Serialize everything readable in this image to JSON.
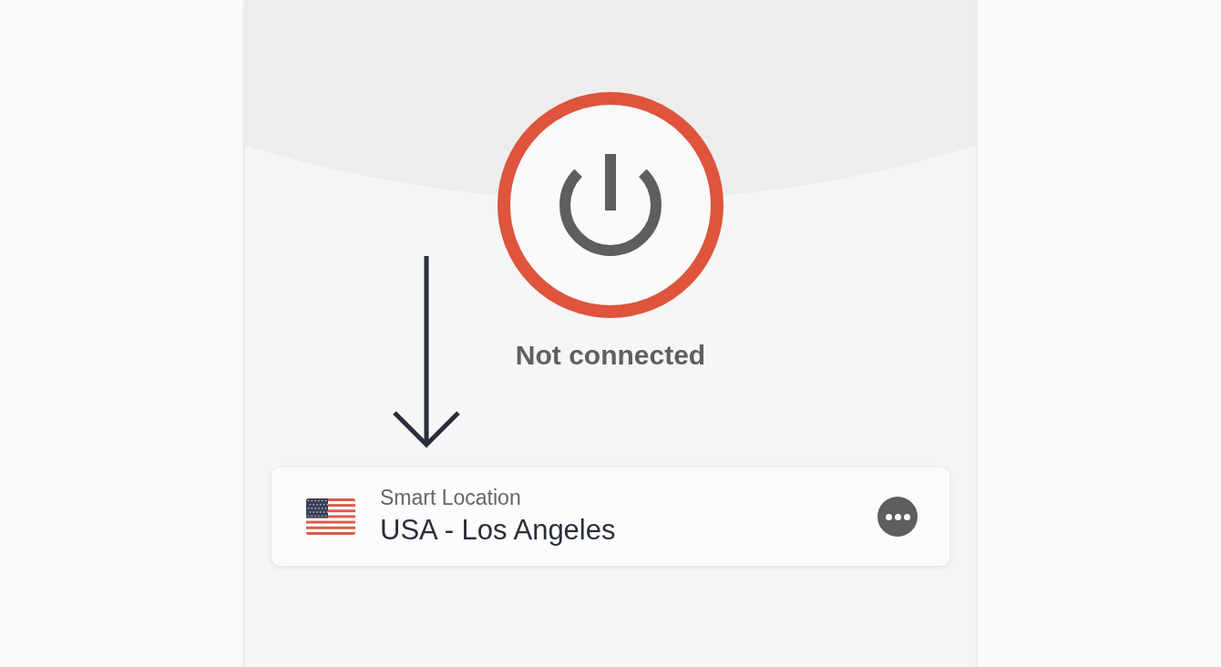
{
  "connection": {
    "status": "Not connected",
    "connected": false
  },
  "location": {
    "label": "Smart Location",
    "name": "USA - Los Angeles"
  }
}
